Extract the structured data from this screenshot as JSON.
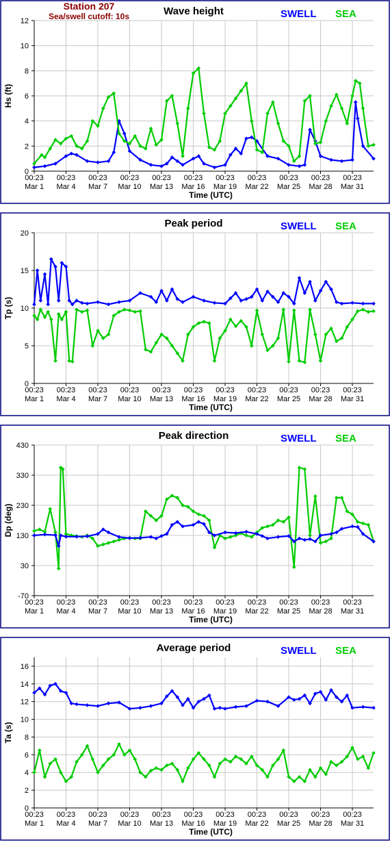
{
  "station": {
    "title": "Station 207",
    "subtitle": "Sea/swell cutoff: 10s"
  },
  "legend": {
    "swell_label": "SWELL",
    "sea_label": "SEA",
    "swell_color": "#0000ff",
    "sea_color": "#00cc00"
  },
  "colors": {
    "frame": "#000080",
    "grid": "#c8c8c8",
    "plot_background": "#ffffff"
  },
  "x_axis": {
    "label": "Time (UTC)",
    "tick_times": [
      "00:23",
      "00:23",
      "00:23",
      "00:23",
      "00:23",
      "00:23",
      "00:23",
      "00:23",
      "00:23",
      "00:23",
      "00:23"
    ],
    "tick_dates": [
      "Mar 1",
      "Mar 4",
      "Mar 7",
      "Mar 10",
      "Mar 13",
      "Mar 16",
      "Mar 19",
      "Mar 22",
      "Mar 25",
      "Mar 28",
      "Mar 31"
    ]
  },
  "chart_data": [
    {
      "type": "line",
      "title": "Wave height",
      "ylabel": "Hs (ft)",
      "ylim": [
        0,
        12
      ],
      "yticks": [
        "0",
        "2",
        "4",
        "6",
        "8",
        "10",
        "12"
      ],
      "xlim": [
        0,
        32
      ],
      "grid": true,
      "series": [
        {
          "name": "SWELL",
          "color": "#0000ff",
          "x": [
            0,
            1,
            2,
            3,
            3.5,
            4,
            5,
            6,
            7,
            7.5,
            8,
            8.5,
            9,
            10,
            11,
            12,
            12.5,
            13,
            13.5,
            14,
            15,
            15.5,
            16,
            17,
            18,
            18.5,
            19,
            19.5,
            20,
            20.5,
            21,
            22,
            23,
            24,
            25,
            25.5,
            26,
            26.5,
            27,
            28,
            29,
            30,
            30.3,
            30.5,
            31,
            32
          ],
          "y": [
            0.3,
            0.4,
            0.6,
            1.2,
            1.4,
            1.3,
            0.8,
            0.7,
            0.8,
            1.5,
            4,
            3,
            1.6,
            0.9,
            0.5,
            0.4,
            0.6,
            1.1,
            0.8,
            0.5,
            1,
            1.2,
            0.6,
            0.3,
            0.5,
            1.3,
            1.8,
            1.4,
            2.6,
            2.7,
            2.4,
            1.2,
            1,
            0.5,
            0.4,
            0.5,
            3.3,
            2.4,
            1.2,
            0.9,
            0.8,
            0.9,
            5.5,
            4.2,
            2,
            1
          ]
        },
        {
          "name": "SEA",
          "color": "#00cc00",
          "x": [
            0,
            0.7,
            1,
            1.5,
            2,
            2.5,
            3,
            3.5,
            4,
            4.5,
            5,
            5.5,
            6,
            6.5,
            7,
            7.5,
            8,
            8.5,
            9,
            9.5,
            10,
            10.5,
            11,
            11.5,
            12,
            12.5,
            13,
            13.5,
            14,
            14.5,
            15,
            15.5,
            16,
            16.5,
            17,
            17.5,
            18,
            18.5,
            19,
            19.5,
            20,
            20.5,
            21,
            21.5,
            22,
            22.5,
            23,
            23.5,
            24,
            24.5,
            25,
            25.5,
            26,
            26.5,
            27,
            27.5,
            28,
            28.5,
            29,
            29.5,
            30,
            30.3,
            30.7,
            31,
            31.5,
            32
          ],
          "y": [
            0.6,
            1.3,
            1.1,
            1.8,
            2.5,
            2.2,
            2.6,
            2.8,
            2,
            1.8,
            2.4,
            4,
            3.6,
            5,
            5.9,
            6.2,
            3,
            2.4,
            2.2,
            2.8,
            2,
            1.8,
            3.4,
            2.1,
            2.5,
            5.6,
            6,
            3.8,
            1.2,
            5,
            7.8,
            8.2,
            4.6,
            1.9,
            1.7,
            2.4,
            4.6,
            5.2,
            5.8,
            6.4,
            7,
            4,
            1.7,
            1.5,
            4.6,
            5.5,
            3.8,
            2.4,
            2,
            0.8,
            1.2,
            5.6,
            6,
            2.2,
            2.3,
            4,
            5.2,
            6.1,
            5,
            3.8,
            6,
            7.2,
            7,
            5,
            2,
            2.1
          ]
        }
      ]
    },
    {
      "type": "line",
      "title": "Peak period",
      "ylabel": "Tp (s)",
      "ylim": [
        0,
        20
      ],
      "yticks": [
        "0",
        "5",
        "10",
        "15",
        "20"
      ],
      "xlim": [
        0,
        32
      ],
      "grid": true,
      "series": [
        {
          "name": "SWELL",
          "color": "#0000ff",
          "x": [
            0,
            0.3,
            0.6,
            1,
            1.3,
            1.6,
            2,
            2.3,
            2.6,
            3,
            3.3,
            3.6,
            4,
            4.5,
            5,
            6,
            7,
            8,
            9,
            10,
            11,
            11.5,
            12,
            12.5,
            13,
            13.5,
            14,
            15,
            16,
            17,
            18,
            18.5,
            19,
            19.5,
            20,
            20.5,
            21,
            21.5,
            22,
            22.5,
            23,
            23.5,
            24,
            24.5,
            25,
            25.5,
            26,
            26.5,
            27,
            27.5,
            28,
            28.5,
            29,
            30,
            31,
            32
          ],
          "y": [
            10.5,
            15,
            11,
            14.5,
            10.5,
            16.5,
            15.5,
            11,
            16,
            15.5,
            11,
            10.5,
            11,
            10.7,
            10.6,
            10.8,
            10.5,
            10.8,
            11,
            12,
            11.5,
            10.8,
            12.3,
            11,
            12.5,
            11.2,
            10.8,
            11.5,
            11,
            10.7,
            10.6,
            11.3,
            12,
            11,
            11.2,
            11.5,
            12.5,
            11,
            12.2,
            11.5,
            10.8,
            12,
            11.5,
            10.6,
            14,
            12,
            13.5,
            11,
            12.3,
            13.5,
            12.5,
            10.8,
            10.6,
            10.7,
            10.6,
            10.6
          ]
        },
        {
          "name": "SEA",
          "color": "#00cc00",
          "x": [
            0,
            0.3,
            0.6,
            1,
            1.3,
            1.6,
            2,
            2.3,
            2.6,
            3,
            3.3,
            3.6,
            4,
            4.5,
            5,
            5.5,
            6,
            6.5,
            7,
            7.5,
            8,
            8.5,
            9,
            9.5,
            10,
            10.5,
            11,
            11.5,
            12,
            12.5,
            13,
            13.5,
            14,
            14.5,
            15,
            15.5,
            16,
            16.5,
            17,
            17.5,
            18,
            18.5,
            19,
            19.5,
            20,
            20.5,
            21,
            21.5,
            22,
            22.5,
            23,
            23.5,
            24,
            24.5,
            25,
            25.5,
            26,
            26.5,
            27,
            27.5,
            28,
            28.5,
            29,
            29.5,
            30,
            30.5,
            31,
            31.5,
            32
          ],
          "y": [
            9,
            8.5,
            9.8,
            8.8,
            9.5,
            8.5,
            3,
            9.2,
            8.5,
            9.5,
            3,
            2.9,
            9.8,
            9.5,
            9.7,
            5,
            7,
            6,
            6.5,
            9,
            9.5,
            9.8,
            9.7,
            9.5,
            9.6,
            4.5,
            4.2,
            5.4,
            6.5,
            6,
            5,
            4,
            3,
            6.5,
            7.5,
            8,
            8.2,
            8,
            3,
            6,
            7,
            8.5,
            7.6,
            8.3,
            7.5,
            5,
            9.7,
            6.5,
            4.4,
            5,
            6,
            9.8,
            2.9,
            9.7,
            3,
            2.8,
            9.8,
            6.5,
            3,
            6.5,
            7.3,
            5.6,
            6,
            7.5,
            8.5,
            9.6,
            9.8,
            9.5,
            9.6
          ]
        }
      ]
    },
    {
      "type": "line",
      "title": "Peak direction",
      "ylabel": "Dp (deg)",
      "ylim": [
        -70,
        430
      ],
      "yticks": [
        "-70",
        "30",
        "130",
        "230",
        "330",
        "430"
      ],
      "xlim": [
        0,
        32
      ],
      "grid": true,
      "series": [
        {
          "name": "SWELL",
          "color": "#0000ff",
          "x": [
            0,
            1,
            2,
            2.3,
            2.5,
            3,
            4,
            5,
            6,
            6.5,
            7,
            8,
            9,
            10,
            11,
            11.5,
            12,
            12.5,
            13,
            13.5,
            14,
            15,
            15.5,
            16,
            16.5,
            17,
            18,
            19,
            20,
            21,
            21.5,
            22,
            23,
            24,
            24.5,
            25,
            25.5,
            26,
            26.5,
            27,
            28,
            28.5,
            29,
            30,
            30.5,
            31,
            32
          ],
          "y": [
            130,
            133,
            131,
            95,
            130,
            126,
            126,
            127,
            135,
            150,
            140,
            125,
            121,
            122,
            125,
            120,
            128,
            135,
            165,
            175,
            160,
            165,
            175,
            168,
            140,
            130,
            140,
            138,
            142,
            135,
            128,
            120,
            125,
            128,
            110,
            120,
            115,
            118,
            110,
            130,
            135,
            140,
            152,
            160,
            158,
            135,
            110
          ]
        },
        {
          "name": "SEA",
          "color": "#00cc00",
          "x": [
            0,
            0.5,
            1,
            1.5,
            2,
            2.3,
            2.5,
            2.7,
            3,
            3.5,
            4,
            4.5,
            5,
            5.5,
            6,
            6.5,
            7,
            7.5,
            8,
            8.5,
            9,
            9.5,
            10,
            10.5,
            11,
            11.5,
            12,
            12.5,
            13,
            13.5,
            14,
            14.5,
            15,
            15.5,
            16,
            16.5,
            17,
            17.5,
            18,
            18.5,
            19,
            19.5,
            20,
            20.5,
            21,
            21.5,
            22,
            22.5,
            23,
            23.5,
            24,
            24.5,
            25,
            25.5,
            26,
            26.5,
            27,
            27.5,
            28,
            28.5,
            29,
            29.5,
            30,
            30.5,
            31,
            31.5,
            32
          ],
          "y": [
            145,
            150,
            142,
            218,
            140,
            20,
            355,
            350,
            135,
            130,
            128,
            125,
            130,
            120,
            95,
            100,
            105,
            110,
            115,
            120,
            122,
            120,
            120,
            210,
            195,
            180,
            195,
            250,
            262,
            255,
            230,
            225,
            210,
            200,
            195,
            180,
            90,
            130,
            120,
            125,
            130,
            138,
            130,
            125,
            140,
            155,
            160,
            165,
            180,
            175,
            190,
            25,
            355,
            350,
            130,
            260,
            105,
            110,
            120,
            255,
            255,
            210,
            200,
            175,
            170,
            165,
            110
          ]
        }
      ]
    },
    {
      "type": "line",
      "title": "Average period",
      "ylabel": "Ta (s)",
      "ylim": [
        0,
        17
      ],
      "yticks": [
        "0",
        "2",
        "4",
        "6",
        "8",
        "10",
        "12",
        "14",
        "16"
      ],
      "xlim": [
        0,
        32
      ],
      "grid": true,
      "series": [
        {
          "name": "SWELL",
          "color": "#0000ff",
          "x": [
            0,
            0.5,
            1,
            1.5,
            2,
            2.5,
            3,
            3.5,
            4,
            5,
            6,
            7,
            8,
            9,
            10,
            11,
            12,
            12.5,
            13,
            13.5,
            14,
            14.5,
            15,
            15.5,
            16,
            16.5,
            17,
            17.5,
            18,
            19,
            20,
            21,
            22,
            23,
            24,
            24.5,
            25,
            25.5,
            26,
            26.5,
            27,
            27.5,
            28,
            28.5,
            29,
            29.5,
            30,
            31,
            32
          ],
          "y": [
            13,
            13.5,
            12.8,
            13.8,
            14,
            13.2,
            13,
            11.8,
            11.7,
            11.6,
            11.5,
            11.8,
            11.9,
            11.2,
            11.3,
            11.5,
            11.8,
            12.6,
            13.2,
            12.5,
            11.6,
            12.3,
            11.3,
            12,
            12.3,
            12.7,
            11.2,
            11.3,
            11.2,
            11.4,
            11.5,
            12.1,
            12,
            11.5,
            12.5,
            12.2,
            12.3,
            12.7,
            11.8,
            12.9,
            13.1,
            12.2,
            13.3,
            12.5,
            12,
            12.7,
            11.3,
            11.4,
            11.3
          ]
        },
        {
          "name": "SEA",
          "color": "#00cc00",
          "x": [
            0,
            0.5,
            1,
            1.5,
            2,
            2.5,
            3,
            3.5,
            4,
            4.5,
            5,
            5.5,
            6,
            6.5,
            7,
            7.5,
            8,
            8.5,
            9,
            9.5,
            10,
            10.5,
            11,
            11.5,
            12,
            12.5,
            13,
            13.5,
            14,
            14.5,
            15,
            15.5,
            16,
            16.5,
            17,
            17.5,
            18,
            18.5,
            19,
            19.5,
            20,
            20.5,
            21,
            21.5,
            22,
            22.5,
            23,
            23.5,
            24,
            24.5,
            25,
            25.5,
            26,
            26.5,
            27,
            27.5,
            28,
            28.5,
            29,
            29.5,
            30,
            30.5,
            31,
            31.5,
            32
          ],
          "y": [
            4,
            6.5,
            3.5,
            5,
            5.5,
            4,
            3,
            3.5,
            5.2,
            6,
            7,
            5.5,
            4,
            4.8,
            5.5,
            6,
            7.2,
            6,
            6.5,
            5.5,
            4,
            3.5,
            4.2,
            4.5,
            4.3,
            4.8,
            5,
            4.3,
            3,
            4.5,
            5.5,
            6.2,
            5.5,
            4.8,
            3.5,
            5,
            5.5,
            5.2,
            5.8,
            5.5,
            5,
            5.8,
            4.8,
            4.3,
            3.5,
            4.8,
            5.5,
            6.5,
            3.5,
            3,
            3.5,
            3,
            4.3,
            3.5,
            4.5,
            3.8,
            5.2,
            4.8,
            5.2,
            5.8,
            6.8,
            5.5,
            5.8,
            4.5,
            6.2
          ]
        }
      ]
    }
  ]
}
